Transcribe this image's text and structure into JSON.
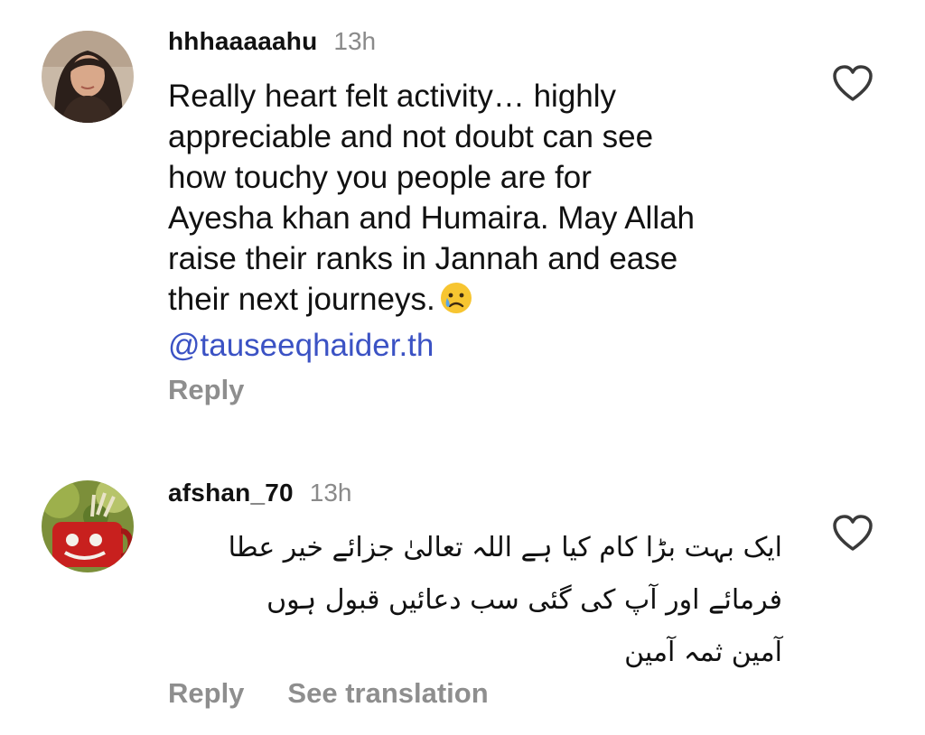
{
  "comments": [
    {
      "username": "hhhaaaaahu",
      "time": "13h",
      "lines": [
        "Really heart felt activity… highly",
        "appreciable and not doubt can see",
        "how touchy you people are for",
        "Ayesha khan and Humaira. May Allah",
        "raise their ranks in Jannah and ease",
        "their next journeys."
      ],
      "emoji": "crying-face",
      "mention": "@tauseeqhaider.th",
      "reply_label": "Reply",
      "avatar": "woman-portrait",
      "like_icon": "heart-outline-icon"
    },
    {
      "username": "afshan_70",
      "time": "13h",
      "lines": [
        "ایک بہت بڑا کام کیا ہے اللہ تعالیٰ جزائے خیر عطا",
        "فرمائے اور آپ کی گئی سب دعائیں قبول ہوں",
        "آمین ثمہ آمین"
      ],
      "reply_label": "Reply",
      "see_translation_label": "See translation",
      "avatar": "red-mug-photo",
      "like_icon": "heart-outline-icon"
    }
  ],
  "colors": {
    "text": "#111111",
    "muted": "#8e8e8e",
    "mention": "#3b52c4",
    "background": "#ffffff"
  }
}
